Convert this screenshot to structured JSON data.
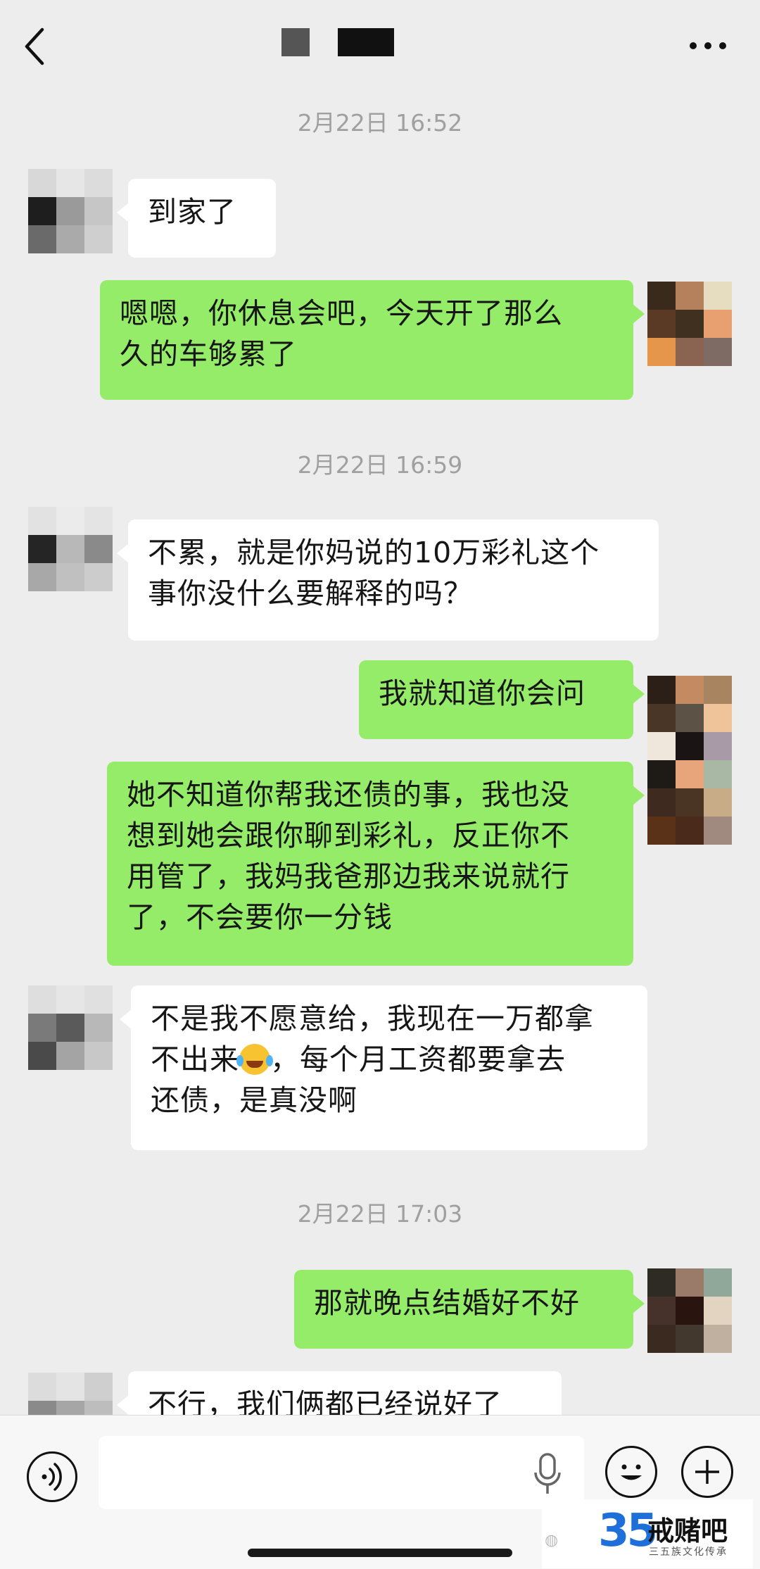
{
  "header": {
    "back_icon": "chevron-left-icon",
    "more_icon": "more-icon"
  },
  "messages": [
    {
      "timestamp": "2月22日 16:52"
    },
    {
      "side": "in",
      "lines": [
        "到家了"
      ]
    },
    {
      "side": "out",
      "lines": [
        "嗯嗯，你休息会吧，今天开了那么",
        "久的车够累了"
      ]
    },
    {
      "timestamp": "2月22日 16:59"
    },
    {
      "side": "in",
      "lines": [
        "不累，就是你妈说的10万彩礼这个",
        "事你没什么要解释的吗？"
      ]
    },
    {
      "side": "out",
      "lines": [
        "我就知道你会问"
      ]
    },
    {
      "side": "out",
      "lines": [
        "她不知道你帮我还债的事，我也没",
        "想到她会跟你聊到彩礼，反正你不",
        "用管了，我妈我爸那边我来说就行",
        "了，不会要你一分钱"
      ]
    },
    {
      "side": "in",
      "lines": [
        "不是我不愿意给，我现在一万都拿",
        "不出来",
        "，每个月工资都要拿去",
        "还债，是真没啊"
      ],
      "emoji": "tears-of-joy-emoji"
    },
    {
      "timestamp": "2月22日 17:03"
    },
    {
      "side": "out",
      "lines": [
        "那就晚点结婚好不好"
      ]
    },
    {
      "side": "in",
      "lines": [
        "不行，我们俩都已经说好了"
      ]
    }
  ],
  "ts1": "2月22日 16:52",
  "ts2": "2月22日 16:59",
  "ts3": "2月22日 17:03",
  "m1": "到家了",
  "m2a": "嗯嗯，你休息会吧，今天开了那么",
  "m2b": "久的车够累了",
  "m3a": "不累，就是你妈说的10万彩礼这个",
  "m3b": "事你没什么要解释的吗？",
  "m4": "我就知道你会问",
  "m5a": "她不知道你帮我还债的事，我也没",
  "m5b": "想到她会跟你聊到彩礼，反正你不",
  "m5c": "用管了，我妈我爸那边我来说就行",
  "m5d": "了，不会要你一分钱",
  "m6a": "不是我不愿意给，我现在一万都拿",
  "m6b1": "不出来",
  "m6b2": "，每个月工资都要拿去",
  "m6c": "还债，是真没啊",
  "m7": "那就晚点结婚好不好",
  "m8": "不行，我们俩都已经说好了",
  "input": {
    "value": ""
  },
  "icons": {
    "voice": "voice-icon",
    "mic": "microphone-icon",
    "emoji": "emoji-icon",
    "plus": "plus-icon"
  },
  "watermark": {
    "number": "35",
    "brand": "戒赌吧",
    "subtitle": "三五族文化传承"
  },
  "colors": {
    "background": "#ededed",
    "incoming_bubble": "#ffffff",
    "outgoing_bubble": "#95ec69"
  }
}
